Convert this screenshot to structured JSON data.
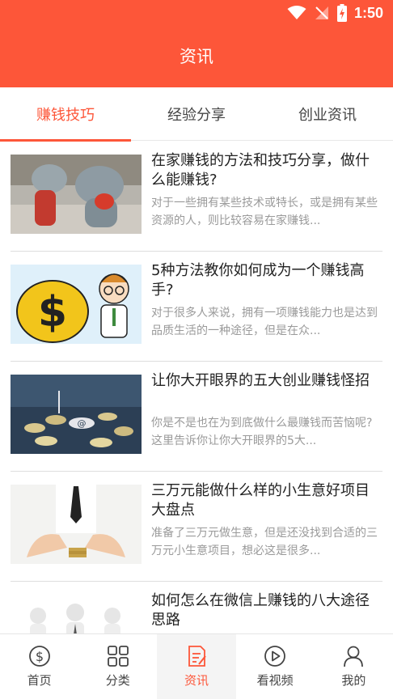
{
  "status_bar": {
    "time": "1:50"
  },
  "header": {
    "title": "资讯"
  },
  "tabs": [
    {
      "label": "赚钱技巧",
      "active": true
    },
    {
      "label": "经验分享",
      "active": false
    },
    {
      "label": "创业资讯",
      "active": false
    }
  ],
  "articles": [
    {
      "title": "在家赚钱的方法和技巧分享，做什么能赚钱?",
      "description": "对于一些拥有某些技术或特长，或是拥有某些资源的人，则比较容易在家赚钱..."
    },
    {
      "title": "5种方法教你如何成为一个赚钱高手?",
      "description": "对于很多人来说，拥有一项赚钱能力也是达到品质生活的一种途径，但是在众..."
    },
    {
      "title": "让你大开眼界的五大创业赚钱怪招",
      "description": "你是不是也在为到底做什么最赚钱而苦恼呢?这里告诉你让你大开眼界的5大..."
    },
    {
      "title": "三万元能做什么样的小生意好项目大盘点",
      "description": "准备了三万元做生意，但是还没找到合适的三万元小生意项目，想必这是很多..."
    },
    {
      "title": "如何怎么在微信上赚钱的八大途径思路",
      "description": ""
    }
  ],
  "bottom_nav": [
    {
      "label": "首页",
      "icon": "dollar-circle-icon",
      "active": false
    },
    {
      "label": "分类",
      "icon": "grid-icon",
      "active": false
    },
    {
      "label": "资讯",
      "icon": "document-icon",
      "active": true
    },
    {
      "label": "看视频",
      "icon": "play-circle-icon",
      "active": false
    },
    {
      "label": "我的",
      "icon": "user-icon",
      "active": false
    }
  ],
  "colors": {
    "accent": "#fd5639",
    "text": "#222222",
    "muted": "#9a9a9a"
  }
}
